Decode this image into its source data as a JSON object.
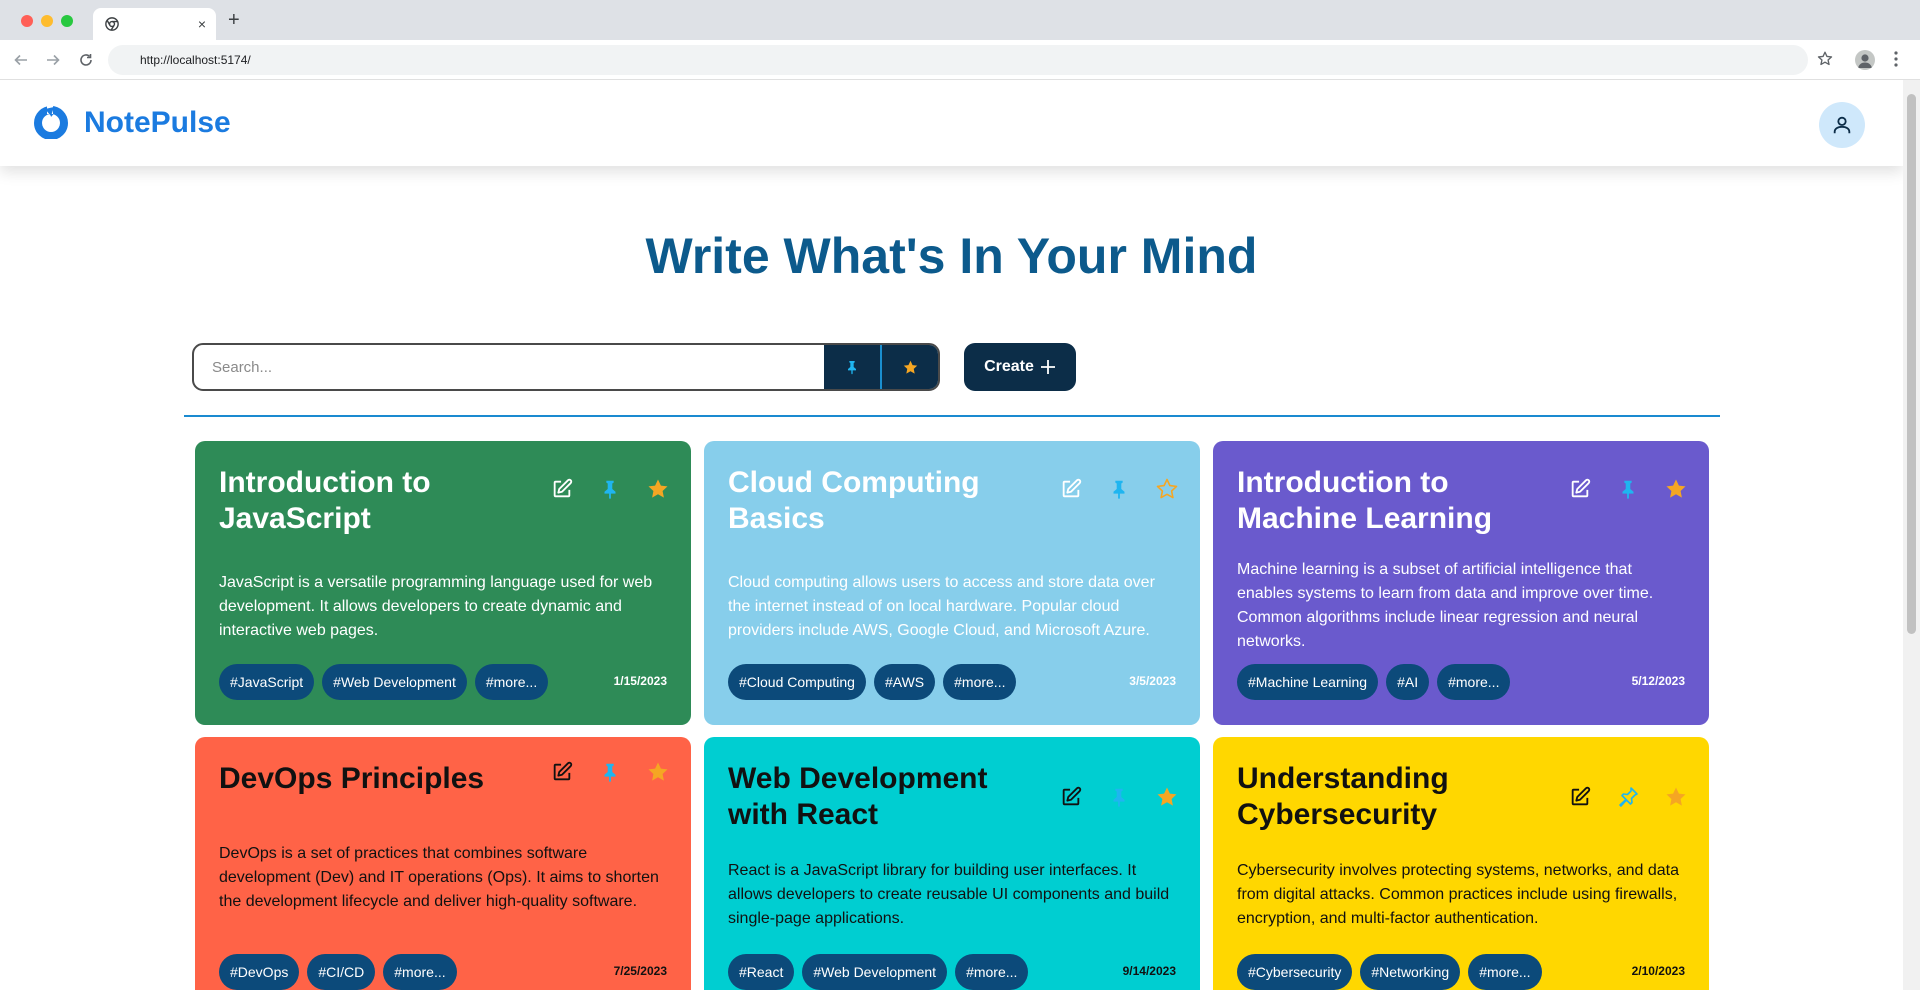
{
  "browser": {
    "tab_close": "×",
    "new_tab": "+",
    "url": "http://localhost:5174/"
  },
  "app": {
    "name": "NotePulse",
    "hero_title": "Write What's In Your Mind",
    "search_placeholder": "Search...",
    "create_label": "Create",
    "colors": {
      "brand": "#1b7be0",
      "dark": "#0c2d48",
      "divider": "#1a8ad0",
      "tag": "#0c4a7a"
    }
  },
  "notes": [
    {
      "title": "Introduction to JavaScript",
      "body": "JavaScript is a versatile programming language used for web development. It allows developers to create dynamic and interactive web pages.",
      "tags": [
        "#JavaScript",
        "#Web Development",
        "#more..."
      ],
      "date": "1/15/2023",
      "color": "#2e8b57",
      "pinned": true,
      "favorite": true
    },
    {
      "title": "Cloud Computing Basics",
      "body": "Cloud computing allows users to access and store data over the internet instead of on local hardware. Popular cloud providers include AWS, Google Cloud, and Microsoft Azure.",
      "tags": [
        "#Cloud Computing",
        "#AWS",
        "#more..."
      ],
      "date": "3/5/2023",
      "color": "#87ceeb",
      "pinned": true,
      "favorite": false
    },
    {
      "title": "Introduction to Machine Learning",
      "body": "Machine learning is a subset of artificial intelligence that enables systems to learn from data and improve over time. Common algorithms include linear regression and neural networks.",
      "tags": [
        "#Machine Learning",
        "#AI",
        "#more..."
      ],
      "date": "5/12/2023",
      "color": "#6a5acd",
      "pinned": true,
      "favorite": true
    },
    {
      "title": "DevOps Principles",
      "body": "DevOps is a set of practices that combines software development (Dev) and IT operations (Ops). It aims to shorten the development lifecycle and deliver high-quality software.",
      "tags": [
        "#DevOps",
        "#CI/CD",
        "#more..."
      ],
      "date": "7/25/2023",
      "color": "#ff6347",
      "pinned": true,
      "favorite": true
    },
    {
      "title": "Web Development with React",
      "body": "React is a JavaScript library for building user interfaces. It allows developers to create reusable UI components and build single-page applications.",
      "tags": [
        "#React",
        "#Web Development",
        "#more..."
      ],
      "date": "9/14/2023",
      "color": "#00ced1",
      "pinned": true,
      "favorite": true
    },
    {
      "title": "Understanding Cybersecurity",
      "body": "Cybersecurity involves protecting systems, networks, and data from digital attacks. Common practices include using firewalls, encryption, and multi-factor authentication.",
      "tags": [
        "#Cybersecurity",
        "#Networking",
        "#more..."
      ],
      "date": "2/10/2023",
      "color": "#ffd700",
      "pinned": false,
      "favorite": true
    }
  ]
}
